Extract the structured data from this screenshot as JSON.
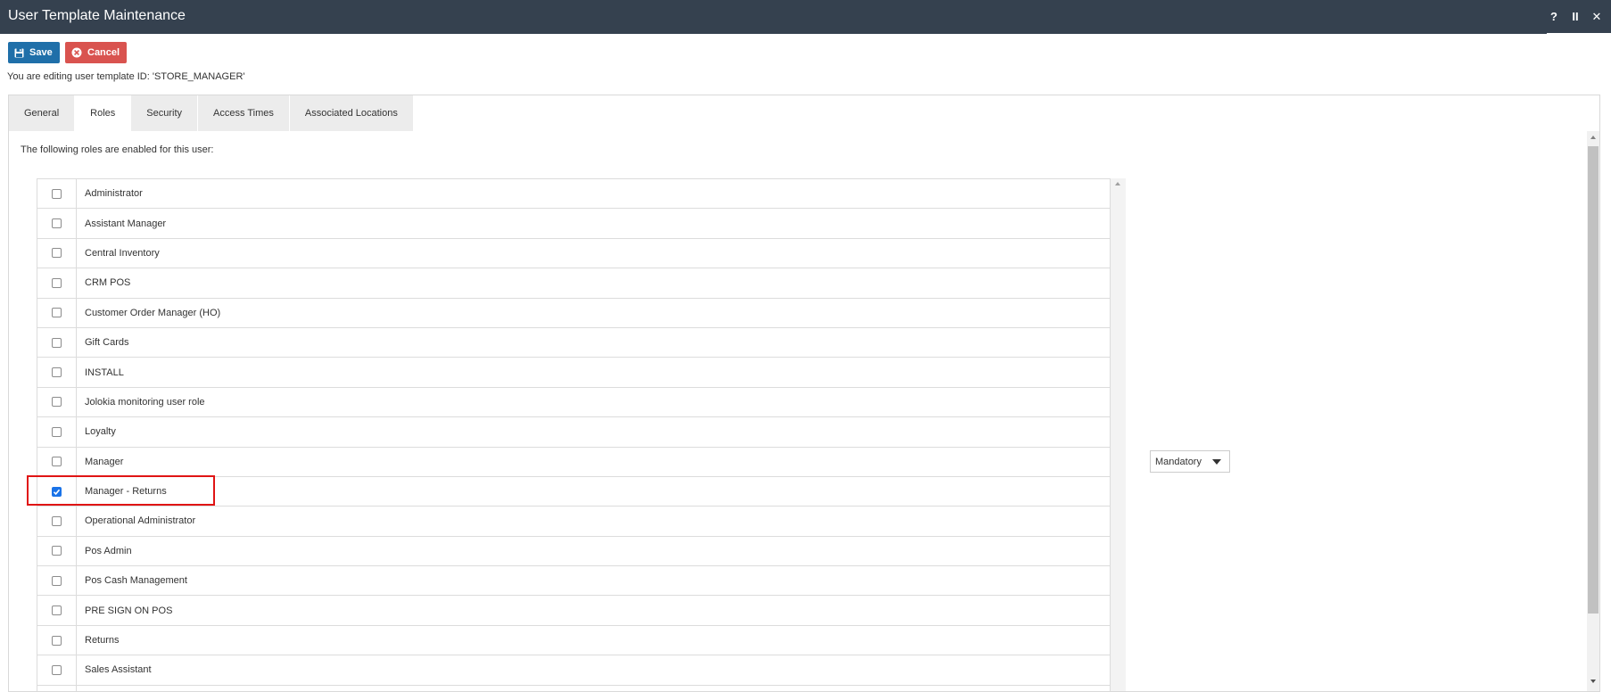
{
  "window": {
    "title": "User Template Maintenance",
    "controls": [
      "?",
      "II",
      "✕"
    ]
  },
  "toolbar": {
    "save_label": "Save",
    "cancel_label": "Cancel"
  },
  "edit_info": "You are editing user template ID: 'STORE_MANAGER'",
  "tabs": [
    {
      "label": "General",
      "active": false
    },
    {
      "label": "Roles",
      "active": true
    },
    {
      "label": "Security",
      "active": false
    },
    {
      "label": "Access Times",
      "active": false
    },
    {
      "label": "Associated Locations",
      "active": false
    }
  ],
  "roles_intro": "The following roles are enabled for this user:",
  "roles": [
    {
      "label": "Administrator",
      "checked": false
    },
    {
      "label": "Assistant Manager",
      "checked": false
    },
    {
      "label": "Central Inventory",
      "checked": false
    },
    {
      "label": "CRM POS",
      "checked": false
    },
    {
      "label": "Customer Order Manager (HO)",
      "checked": false
    },
    {
      "label": "Gift Cards",
      "checked": false
    },
    {
      "label": "INSTALL",
      "checked": false
    },
    {
      "label": "Jolokia monitoring user role",
      "checked": false
    },
    {
      "label": "Loyalty",
      "checked": false
    },
    {
      "label": "Manager",
      "checked": false
    },
    {
      "label": "Manager - Returns",
      "checked": true
    },
    {
      "label": "Operational Administrator",
      "checked": false
    },
    {
      "label": "Pos Admin",
      "checked": false
    },
    {
      "label": "Pos Cash Management",
      "checked": false
    },
    {
      "label": "PRE SIGN ON POS",
      "checked": false
    },
    {
      "label": "Returns",
      "checked": false
    },
    {
      "label": "Sales Assistant",
      "checked": false
    }
  ],
  "role_requirement": {
    "selected": "Mandatory"
  },
  "colors": {
    "titlebar": "#35414f",
    "save": "#1f6fa9",
    "cancel": "#d9534f",
    "highlight": "#e01414",
    "checkbox_checked": "#1a73e8"
  }
}
